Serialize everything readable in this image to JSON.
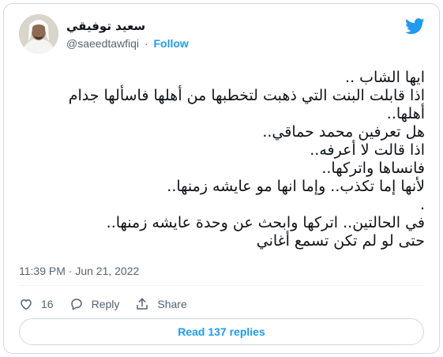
{
  "author": {
    "display_name": "سعيد توفيقي",
    "handle": "@saeedtawfiqi",
    "separator": "·",
    "follow_label": "Follow",
    "avatar": "avatar-photo"
  },
  "brand": {
    "icon": "twitter-bird-icon",
    "color": "#1d9bf0"
  },
  "tweet": {
    "lines": [
      "ايها الشاب ..",
      "اذا قابلت البنت التي ذهبت لتخطبها من أهلها فاسألها جدام",
      "أهلها..",
      "هل تعرفين محمد حماقي..",
      "اذا قالت لا أعرفه..",
      "فانساها واتركها..",
      "لأنها إما تكذب.. وإما انها مو عايشه زمنها..",
      ".",
      "في الحالتين.. اتركها وابحث عن وحدة عايشه زمنها..",
      "حتى لو لم تكن تسمع أغاني"
    ]
  },
  "meta": {
    "timestamp": "11:39 PM · Jun 21, 2022"
  },
  "actions": {
    "like_count": "16",
    "reply_label": "Reply",
    "share_label": "Share"
  },
  "replies_button": {
    "label": "Read 137 replies"
  }
}
